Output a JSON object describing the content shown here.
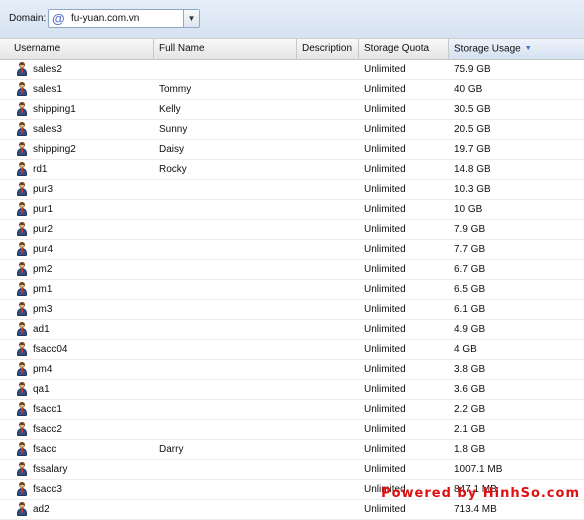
{
  "domain": {
    "label": "Domain:",
    "value": "fu-yuan.com.vn"
  },
  "columns": {
    "username": "Username",
    "full_name": "Full Name",
    "description": "Description",
    "storage_quota": "Storage Quota",
    "storage_usage": "Storage Usage"
  },
  "rows": [
    {
      "username": "sales2",
      "full_name": "",
      "description": "",
      "quota": "Unlimited",
      "usage": "75.9 GB"
    },
    {
      "username": "sales1",
      "full_name": "Tommy",
      "description": "",
      "quota": "Unlimited",
      "usage": "40 GB"
    },
    {
      "username": "shipping1",
      "full_name": "Kelly",
      "description": "",
      "quota": "Unlimited",
      "usage": "30.5 GB"
    },
    {
      "username": "sales3",
      "full_name": "Sunny",
      "description": "",
      "quota": "Unlimited",
      "usage": "20.5 GB"
    },
    {
      "username": "shipping2",
      "full_name": "Daisy",
      "description": "",
      "quota": "Unlimited",
      "usage": "19.7 GB"
    },
    {
      "username": "rd1",
      "full_name": "Rocky",
      "description": "",
      "quota": "Unlimited",
      "usage": "14.8 GB"
    },
    {
      "username": "pur3",
      "full_name": "",
      "description": "",
      "quota": "Unlimited",
      "usage": "10.3 GB"
    },
    {
      "username": "pur1",
      "full_name": "",
      "description": "",
      "quota": "Unlimited",
      "usage": "10 GB"
    },
    {
      "username": "pur2",
      "full_name": "",
      "description": "",
      "quota": "Unlimited",
      "usage": "7.9 GB"
    },
    {
      "username": "pur4",
      "full_name": "",
      "description": "",
      "quota": "Unlimited",
      "usage": "7.7 GB"
    },
    {
      "username": "pm2",
      "full_name": "",
      "description": "",
      "quota": "Unlimited",
      "usage": "6.7 GB"
    },
    {
      "username": "pm1",
      "full_name": "",
      "description": "",
      "quota": "Unlimited",
      "usage": "6.5 GB"
    },
    {
      "username": "pm3",
      "full_name": "",
      "description": "",
      "quota": "Unlimited",
      "usage": "6.1 GB"
    },
    {
      "username": "ad1",
      "full_name": "",
      "description": "",
      "quota": "Unlimited",
      "usage": "4.9 GB"
    },
    {
      "username": "fsacc04",
      "full_name": "",
      "description": "",
      "quota": "Unlimited",
      "usage": "4 GB"
    },
    {
      "username": "pm4",
      "full_name": "",
      "description": "",
      "quota": "Unlimited",
      "usage": "3.8 GB"
    },
    {
      "username": "qa1",
      "full_name": "",
      "description": "",
      "quota": "Unlimited",
      "usage": "3.6 GB"
    },
    {
      "username": "fsacc1",
      "full_name": "",
      "description": "",
      "quota": "Unlimited",
      "usage": "2.2 GB"
    },
    {
      "username": "fsacc2",
      "full_name": "",
      "description": "",
      "quota": "Unlimited",
      "usage": "2.1 GB"
    },
    {
      "username": "fsacc",
      "full_name": "Darry",
      "description": "",
      "quota": "Unlimited",
      "usage": "1.8 GB"
    },
    {
      "username": "fssalary",
      "full_name": "",
      "description": "",
      "quota": "Unlimited",
      "usage": "1007.1 MB"
    },
    {
      "username": "fsacc3",
      "full_name": "",
      "description": "",
      "quota": "Unlimited",
      "usage": "847.1 MB"
    },
    {
      "username": "ad2",
      "full_name": "",
      "description": "",
      "quota": "Unlimited",
      "usage": "713.4 MB"
    }
  ],
  "watermark": "Powered by HinhSo.com",
  "icons": {
    "domain": "at-sign-icon",
    "dropdown": "chevron-down-icon",
    "sort": "sort-descending-icon",
    "user": "user-icon"
  }
}
